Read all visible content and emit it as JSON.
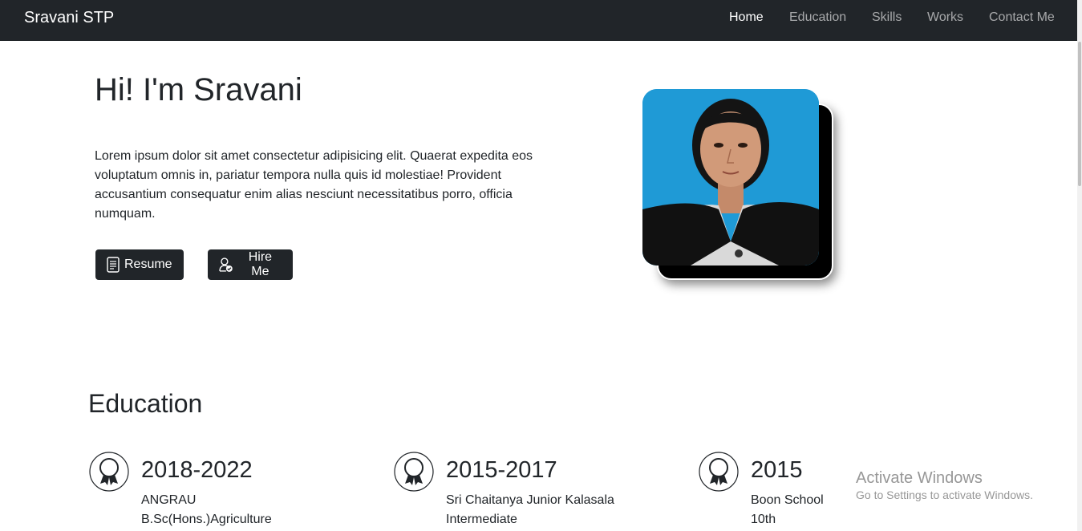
{
  "navbar": {
    "brand": "Sravani STP",
    "links": [
      "Home",
      "Education",
      "Skills",
      "Works",
      "Contact Me"
    ],
    "active": "Home"
  },
  "hero": {
    "title": "Hi! I'm Sravani",
    "text": "Lorem ipsum dolor sit amet consectetur adipisicing elit. Quaerat expedita eos voluptatum omnis in, pariatur tempora nulla quis id molestiae! Provident accusantium consequatur enim alias nesciunt necessitatibus porro, officia numquam.",
    "buttons": {
      "resume": {
        "label": "Resume",
        "icon": "document-icon"
      },
      "hire": {
        "label": "Hire Me",
        "icon": "person-check-icon"
      }
    }
  },
  "education": {
    "title": "Education",
    "items": [
      {
        "year": "2018-2022",
        "line1": "ANGRAU",
        "line2": "B.Sc(Hons.)Agriculture",
        "icon": "award-icon"
      },
      {
        "year": "2015-2017",
        "line1": "Sri Chaitanya Junior Kalasala",
        "line2": "Intermediate",
        "icon": "award-icon"
      },
      {
        "year": "2015",
        "line1": "Boon School",
        "line2": "10th",
        "icon": "award-icon"
      }
    ]
  },
  "watermark": {
    "title": "Activate Windows",
    "subtitle": "Go to Settings to activate Windows."
  },
  "colors": {
    "navbar_bg": "#212529",
    "button_bg": "#212529",
    "photo_bg": "#1f9ad6"
  }
}
